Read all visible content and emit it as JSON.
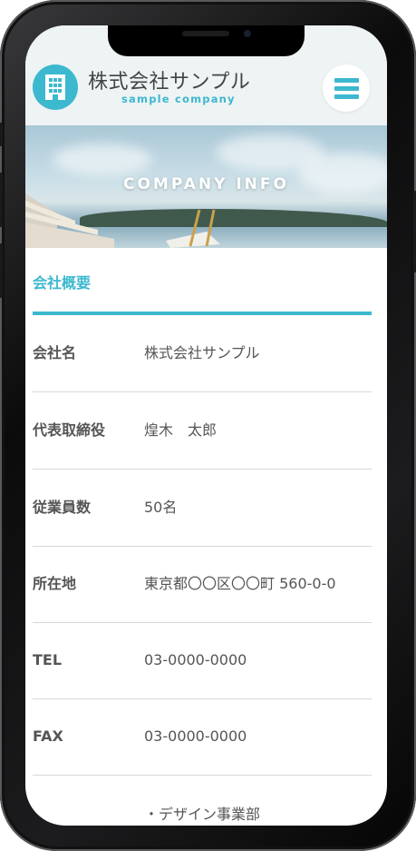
{
  "header": {
    "company_name": "株式会社サンプル",
    "company_sub": "sample company",
    "logo_icon": "building-icon",
    "menu_icon": "hamburger-menu-icon"
  },
  "hero": {
    "title": "COMPANY INFO"
  },
  "section": {
    "title": "会社概要"
  },
  "info": [
    {
      "label": "会社名",
      "value": "株式会社サンプル"
    },
    {
      "label": "代表取締役",
      "value": "煌木　太郎"
    },
    {
      "label": "従業員数",
      "value": "50名"
    },
    {
      "label": "所在地",
      "value": "東京都〇〇区〇〇町 560-0-0"
    },
    {
      "label": "TEL",
      "value": "03-0000-0000"
    },
    {
      "label": "FAX",
      "value": "03-0000-0000"
    }
  ],
  "business": {
    "first_item": "・デザイン事業部"
  },
  "colors": {
    "accent": "#3cb8cf",
    "text": "#555555",
    "header_bg": "#eef3f4"
  }
}
